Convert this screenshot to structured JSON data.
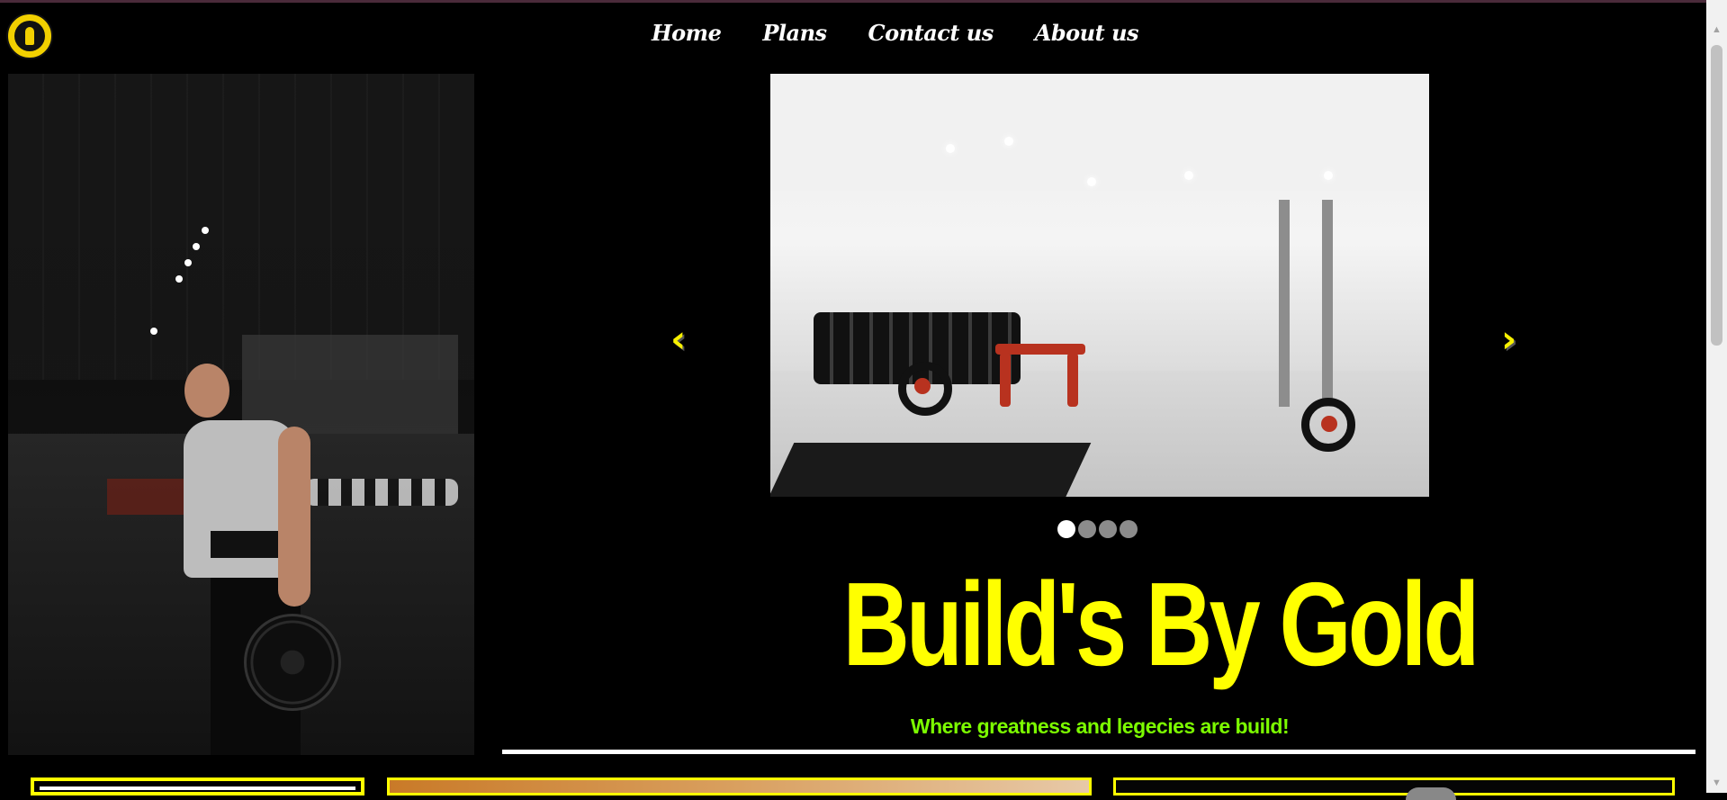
{
  "logo": {
    "icon": "golds-gym-logo-icon"
  },
  "nav": {
    "items": [
      {
        "label": "Home"
      },
      {
        "label": "Plans"
      },
      {
        "label": "Contact us"
      },
      {
        "label": "About us"
      }
    ]
  },
  "hero": {
    "left_image": "gym-man-with-plate-photo",
    "carousel": {
      "image": "white-gym-interior-photo",
      "prev_icon": "‹",
      "next_icon": "›",
      "slide_count": 4,
      "active_slide": 1
    },
    "headline": "Build's By Gold",
    "tagline": "Where greatness and legecies are build!"
  },
  "colors": {
    "background": "#000000",
    "headline": "#ffff00",
    "tagline": "#7cfc00",
    "accent": "#ffff00",
    "nav_text": "#ffffff"
  }
}
